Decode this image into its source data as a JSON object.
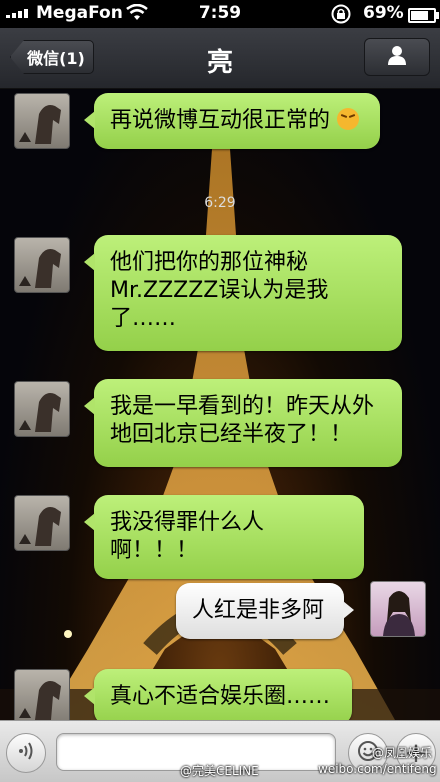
{
  "status_bar": {
    "carrier": "MegaFon",
    "time": "7:59",
    "battery": "69%",
    "battery_level": 0.69
  },
  "nav": {
    "back_label": "微信(1)",
    "title": "亮"
  },
  "chat": {
    "timestamp": "6:29",
    "messages": [
      {
        "side": "left",
        "text": "再说微博互动很正常的",
        "emoji": "angry-face-emoji"
      },
      {
        "side": "left",
        "text": "他们把你的那位神秘Mr.ZZZZZ误认为是我了……"
      },
      {
        "side": "left",
        "text": "我是一早看到的！昨天从外地回北京已经半夜了！！"
      },
      {
        "side": "left",
        "text": "我没得罪什么人啊！！！"
      },
      {
        "side": "right",
        "text": "人红是非多阿"
      },
      {
        "side": "left",
        "text": "真心不适合娱乐圈……"
      }
    ]
  },
  "input_bar": {
    "placeholder": ""
  },
  "watermarks": {
    "bottom_left": "@完美CELINE",
    "bottom_right_top": "@凤凰娱乐",
    "bottom_right": "weibo.com/entifeng"
  }
}
